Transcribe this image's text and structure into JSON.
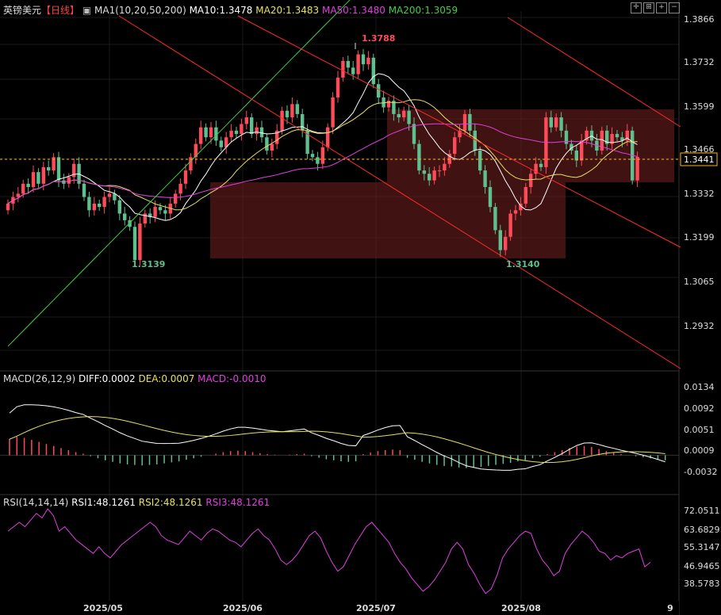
{
  "header": {
    "symbol": "英镑美元",
    "period": "【日线】",
    "ma_group": "MA1(10,20,50,200)",
    "ma10": "MA10:1.3478",
    "ma20": "MA20:1.3483",
    "ma50": "MA50:1.3480",
    "ma200": "MA200:1.3059"
  },
  "macd_header": {
    "name": "MACD(26,12,9)",
    "diff": "DIFF:0.0002",
    "dea": "DEA:0.0007",
    "macd": "MACD:-0.0010"
  },
  "rsi_header": {
    "name": "RSI(14,14,14)",
    "rsi1": "RSI1:48.1261",
    "rsi2": "RSI2:48.1261",
    "rsi3": "RSI3:48.1261"
  },
  "colors": {
    "up": "#ff4a5a",
    "down": "#5fbf8f",
    "ma10": "#ffffff",
    "ma20": "#e8e060",
    "ma50": "#e040e0",
    "ma200": "#40d040",
    "channel": "#ff2a2a",
    "box": "#6b1e1e",
    "current": "#ffb020"
  },
  "chart_data": {
    "type": "candlestick",
    "x_labels": [
      "2025/05",
      "2025/06",
      "2025/07",
      "2025/08",
      "9"
    ],
    "price_ticks": [
      "1.3866",
      "1.3732",
      "1.3599",
      "1.3466",
      "1.3332",
      "1.3199",
      "1.3065",
      "1.2932"
    ],
    "current_price": "1.3441",
    "annotations": {
      "high": "1.3788",
      "low1": "1.3139",
      "low2": "1.3140"
    },
    "macd_ticks": [
      "0.0134",
      "0.0092",
      "0.0051",
      "0.0009",
      "-0.0032"
    ],
    "rsi_ticks": [
      "72.0511",
      "63.6829",
      "55.3147",
      "46.9465",
      "38.5783"
    ],
    "closes": [
      1.33,
      1.332,
      1.333,
      1.336,
      1.335,
      1.3395,
      1.336,
      1.341,
      1.34,
      1.344,
      1.337,
      1.336,
      1.338,
      1.342,
      1.336,
      1.332,
      1.328,
      1.33,
      1.329,
      1.332,
      1.333,
      1.331,
      1.327,
      1.325,
      1.323,
      1.313,
      1.324,
      1.327,
      1.326,
      1.329,
      1.328,
      1.327,
      1.33,
      1.333,
      1.336,
      1.34,
      1.344,
      1.348,
      1.353,
      1.35,
      1.353,
      1.349,
      1.347,
      1.35,
      1.352,
      1.351,
      1.354,
      1.356,
      1.351,
      1.353,
      1.35,
      1.346,
      1.348,
      1.352,
      1.358,
      1.356,
      1.36,
      1.357,
      1.352,
      1.345,
      1.344,
      1.342,
      1.347,
      1.353,
      1.362,
      1.368,
      1.373,
      1.371,
      1.369,
      1.375,
      1.372,
      1.374,
      1.366,
      1.362,
      1.359,
      1.361,
      1.357,
      1.356,
      1.358,
      1.354,
      1.348,
      1.34,
      1.339,
      1.337,
      1.34,
      1.34,
      1.342,
      1.345,
      1.35,
      1.352,
      1.357,
      1.352,
      1.346,
      1.34,
      1.335,
      1.329,
      1.322,
      1.316,
      1.32,
      1.327,
      1.328,
      1.33,
      1.335,
      1.339,
      1.342,
      1.341,
      1.356,
      1.353,
      1.356,
      1.352,
      1.348,
      1.346,
      1.343,
      1.349,
      1.352,
      1.349,
      1.346,
      1.352,
      1.348,
      1.351,
      1.35,
      1.349,
      1.352,
      1.337,
      1.3441
    ],
    "rsi": [
      62,
      64,
      66,
      64,
      67,
      70,
      68,
      72,
      69,
      62,
      64,
      61,
      58,
      56,
      54,
      52,
      55,
      52,
      50,
      53,
      56,
      58,
      60,
      62,
      64,
      66,
      64,
      60,
      58,
      57,
      56,
      59,
      62,
      60,
      58,
      61,
      63,
      62,
      60,
      58,
      57,
      55,
      58,
      61,
      63,
      60,
      58,
      54,
      49,
      47,
      49,
      52,
      56,
      60,
      62,
      59,
      53,
      48,
      44,
      46,
      51,
      56,
      60,
      64,
      66,
      63,
      60,
      57,
      52,
      48,
      45,
      41,
      38,
      35,
      37,
      40,
      44,
      48,
      54,
      57,
      54,
      47,
      43,
      38,
      34,
      36,
      42,
      50,
      54,
      57,
      60,
      62,
      61,
      54,
      49,
      46,
      42,
      44,
      52,
      56,
      59,
      62,
      60,
      57,
      53,
      52,
      49,
      51,
      50,
      52,
      53,
      54,
      46,
      48
    ],
    "macd_hist": [
      0.0032,
      0.0036,
      0.0034,
      0.003,
      0.0026,
      0.0022,
      0.0018,
      0.0014,
      0.001,
      0.0006,
      0.0003,
      -0.0002,
      -0.0006,
      -0.001,
      -0.0013,
      -0.0016,
      -0.0018,
      -0.0019,
      -0.002,
      -0.0019,
      -0.0018,
      -0.0016,
      -0.0014,
      -0.0012,
      -0.0009,
      -0.0006,
      -0.0003,
      0.0,
      0.0003,
      0.0006,
      0.0008,
      0.0009,
      0.0008,
      0.0006,
      0.0004,
      0.0002,
      0.0001,
      0.0,
      0.0001,
      0.0002,
      0.0003,
      -0.0002,
      -0.0005,
      -0.0008,
      -0.001,
      -0.0012,
      -0.0013,
      -0.0012,
      0.0002,
      0.0005,
      0.0008,
      0.001,
      0.0011,
      0.001,
      -0.0005,
      -0.0009,
      -0.0013,
      -0.0016,
      -0.0019,
      -0.0021,
      -0.0022,
      -0.0024,
      -0.0025,
      -0.0024,
      -0.0023,
      -0.0021,
      -0.0019,
      -0.0017,
      -0.0015,
      -0.0012,
      -0.001,
      -0.0006,
      -0.0003,
      0.0002,
      0.0006,
      0.001,
      0.0014,
      0.0017,
      0.0018,
      0.0016,
      0.0012,
      0.0008,
      0.0005,
      0.0002,
      0.0,
      -0.0002,
      -0.0004,
      -0.0006,
      -0.0008,
      -0.001
    ]
  }
}
